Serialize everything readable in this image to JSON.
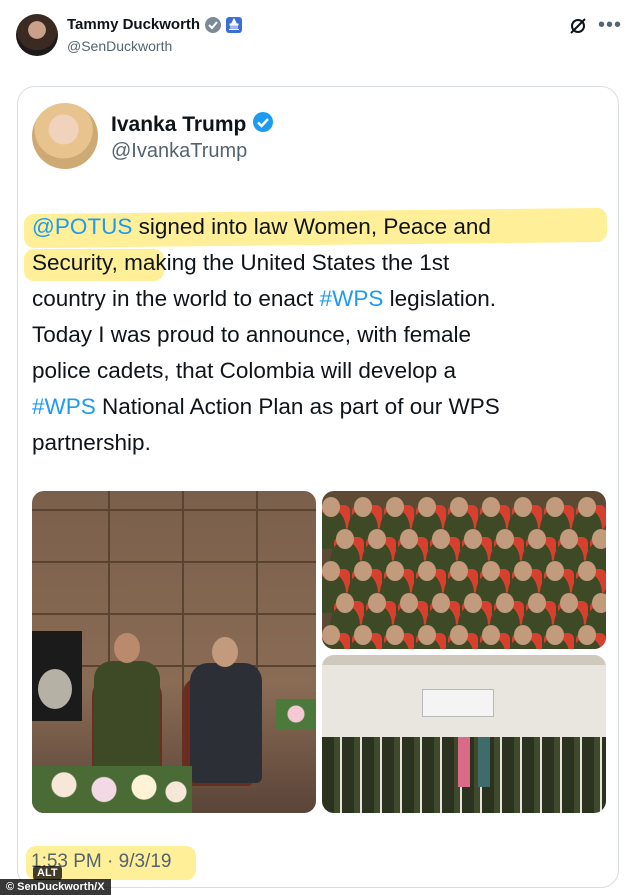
{
  "author": {
    "name": "Tammy Duckworth",
    "handle": "@SenDuckworth"
  },
  "quoted": {
    "name": "Ivanka Trump",
    "handle": "@IvankaTrump",
    "text_lines": [
      [
        {
          "t": "@POTUS",
          "link": true
        },
        {
          "t": " signed into law Women, Peace and",
          "link": false
        }
      ],
      [
        {
          "t": "Security, making the United States the 1st",
          "link": false
        }
      ],
      [
        {
          "t": "country in the world to enact ",
          "link": false
        },
        {
          "t": "#WPS",
          "link": true
        },
        {
          "t": " legislation.",
          "link": false
        }
      ],
      [
        {
          "t": "Today I was proud to announce, with female",
          "link": false
        }
      ],
      [
        {
          "t": "police cadets, that Colombia will develop a",
          "link": false
        }
      ],
      [
        {
          "t": "#WPS",
          "link": true
        },
        {
          "t": " National Action Plan as part of our WPS",
          "link": false
        }
      ],
      [
        {
          "t": "partnership.",
          "link": false
        }
      ]
    ]
  },
  "timestamp": "1:53 PM · 9/3/19",
  "alt_label": "ALT",
  "credit": "© SenDuckworth/X",
  "colors": {
    "verified_blue": "#1d9bf0",
    "link_blue": "#1d9bf0",
    "highlight": "#ffe244",
    "secondary_text": "#536471"
  },
  "icons": {
    "verified": "verified-badge-icon",
    "government": "government-badge-icon",
    "capitol": "capitol-icon",
    "grok": "grok-icon",
    "more": "more-icon"
  }
}
